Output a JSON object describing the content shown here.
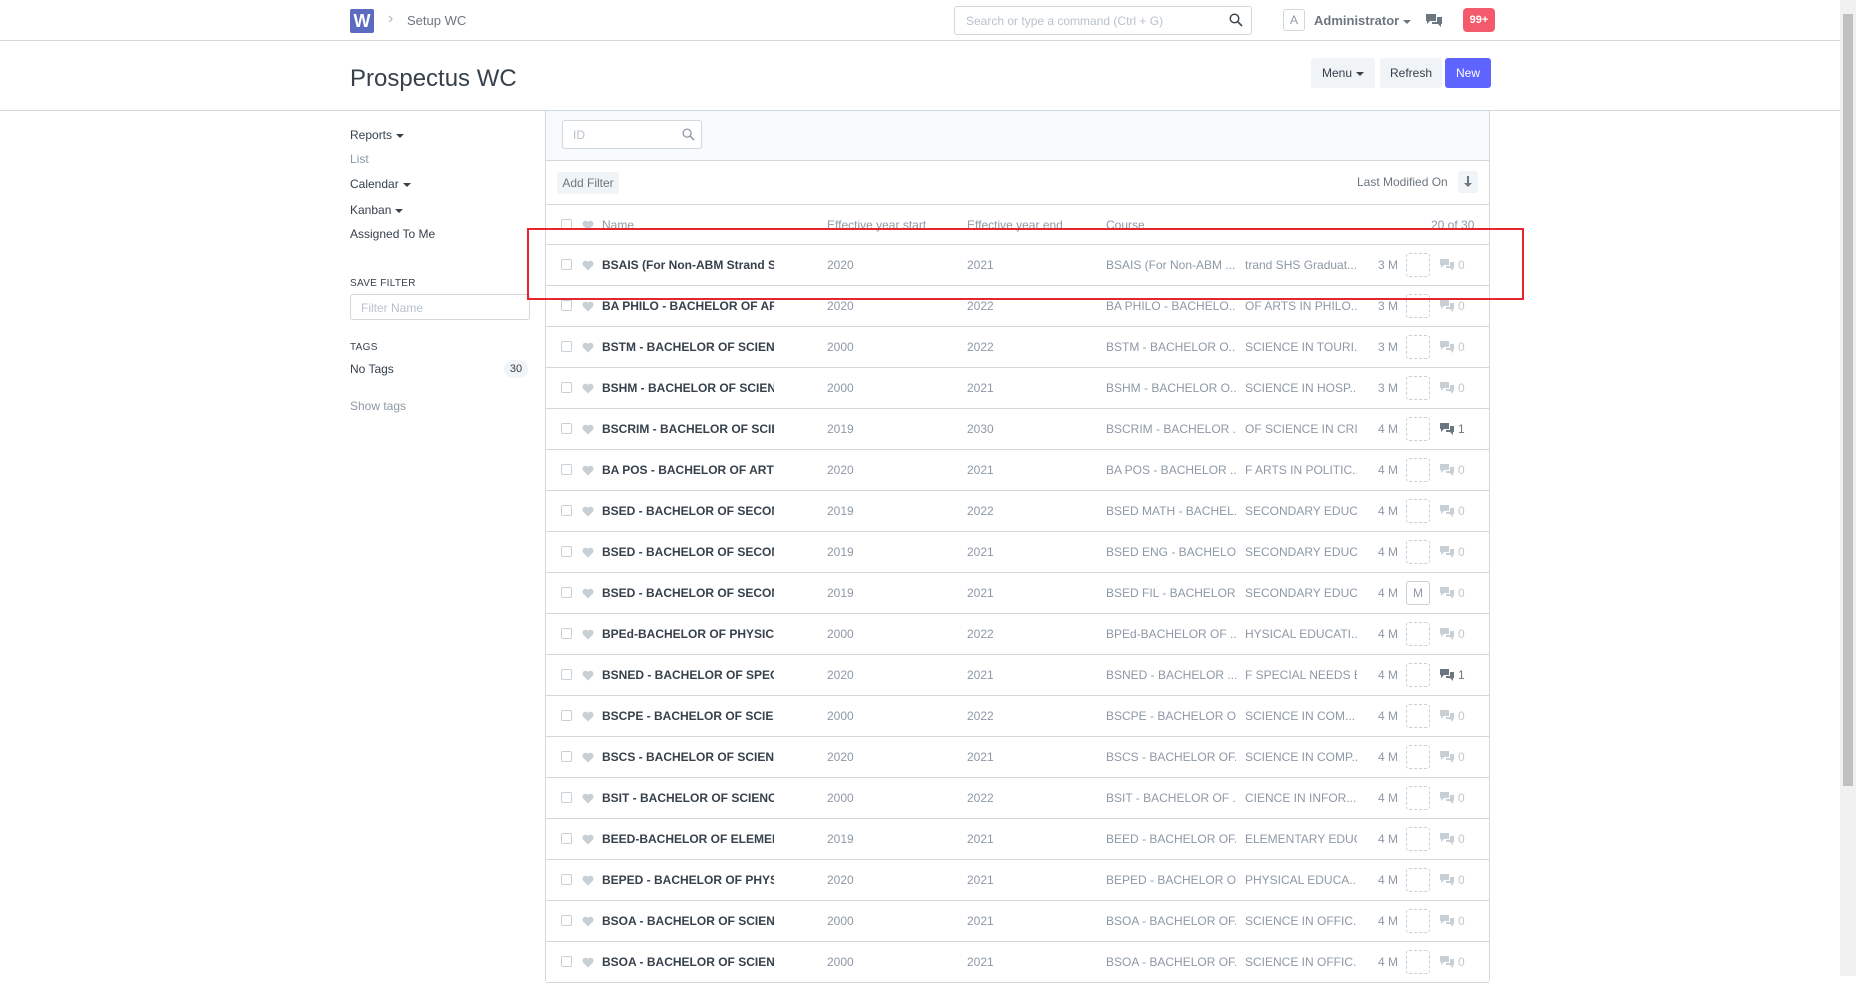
{
  "navbar": {
    "logo": "W",
    "breadcrumb": "Setup WC",
    "search_placeholder": "Search or type a command (Ctrl + G)",
    "avatar_initial": "A",
    "user": "Administrator",
    "notifications": "99+"
  },
  "page": {
    "title": "Prospectus WC",
    "menu_label": "Menu",
    "refresh_label": "Refresh",
    "new_label": "New"
  },
  "sidebar": {
    "reports": "Reports",
    "list": "List",
    "calendar": "Calendar",
    "kanban": "Kanban",
    "assigned": "Assigned To Me",
    "save_filter_head": "SAVE FILTER",
    "filter_placeholder": "Filter Name",
    "tags_head": "TAGS",
    "no_tags": "No Tags",
    "no_tags_count": "30",
    "show_tags": "Show tags"
  },
  "list": {
    "id_placeholder": "ID",
    "add_filter": "Add Filter",
    "sort_label": "Last Modified On",
    "headers": {
      "name": "Name",
      "year_start": "Effective year start",
      "year_end": "Effective year end",
      "course": "Course",
      "count": "20 of 30"
    },
    "rows": [
      {
        "name": "BSAIS (For Non-ABM Strand SHS Graduates)",
        "start": "2020",
        "end": "2021",
        "course1": "BSAIS (For Non-ABM ...",
        "course2": "trand SHS Graduat...",
        "modified": "3 M",
        "assign": "",
        "comments": "0"
      },
      {
        "name": "BA PHILO - BACHELOR OF ARTS IN PHILOSOPHY",
        "start": "2020",
        "end": "2022",
        "course1": "BA PHILO - BACHELO...",
        "course2": "OF ARTS IN PHILO...",
        "modified": "3 M",
        "assign": "",
        "comments": "0"
      },
      {
        "name": "BSTM - BACHELOR OF SCIENCE IN TOURISM",
        "start": "2000",
        "end": "2022",
        "course1": "BSTM - BACHELOR O...",
        "course2": "SCIENCE IN TOURI...",
        "modified": "3 M",
        "assign": "",
        "comments": "0"
      },
      {
        "name": "BSHM - BACHELOR OF SCIENCE IN HOSPITALITY",
        "start": "2000",
        "end": "2021",
        "course1": "BSHM - BACHELOR O...",
        "course2": "SCIENCE IN HOSP...",
        "modified": "3 M",
        "assign": "",
        "comments": "0"
      },
      {
        "name": "BSCRIM - BACHELOR OF SCIENCE IN CRIMINOLOGY",
        "start": "2019",
        "end": "2030",
        "course1": "BSCRIM - BACHELOR ...",
        "course2": "OF SCIENCE IN CRI...",
        "modified": "4 M",
        "assign": "",
        "comments": "1"
      },
      {
        "name": "BA POS - BACHELOR OF ARTS IN POLITICAL SCIENCE",
        "start": "2020",
        "end": "2021",
        "course1": "BA POS - BACHELOR ...",
        "course2": "F ARTS IN POLITIC...",
        "modified": "4 M",
        "assign": "",
        "comments": "0"
      },
      {
        "name": "BSED - BACHELOR OF SECONDARY EDUCATION",
        "start": "2019",
        "end": "2022",
        "course1": "BSED MATH - BACHEL...",
        "course2": "SECONDARY EDUC...",
        "modified": "4 M",
        "assign": "",
        "comments": "0"
      },
      {
        "name": "BSED - BACHELOR OF SECONDARY EDUCATION",
        "start": "2019",
        "end": "2021",
        "course1": "BSED ENG - BACHELO...",
        "course2": "SECONDARY EDUC...",
        "modified": "4 M",
        "assign": "",
        "comments": "0"
      },
      {
        "name": "BSED - BACHELOR OF SECONDARY EDUCATION",
        "start": "2019",
        "end": "2021",
        "course1": "BSED FIL - BACHELOR...",
        "course2": "SECONDARY EDUC...",
        "modified": "4 M",
        "assign": "M",
        "comments": "0"
      },
      {
        "name": "BPEd-BACHELOR OF PHYSICAL EDUCATION",
        "start": "2000",
        "end": "2022",
        "course1": "BPEd-BACHELOR OF ...",
        "course2": "HYSICAL EDUCATI...",
        "modified": "4 M",
        "assign": "",
        "comments": "0"
      },
      {
        "name": "BSNED - BACHELOR OF SPECIAL NEEDS EDUCATION",
        "start": "2020",
        "end": "2021",
        "course1": "BSNED - BACHELOR ...",
        "course2": "F SPECIAL NEEDS E...",
        "modified": "4 M",
        "assign": "",
        "comments": "1"
      },
      {
        "name": "BSCPE - BACHELOR OF SCIENCE IN COMPUTER ENGINEERING",
        "start": "2000",
        "end": "2022",
        "course1": "BSCPE - BACHELOR O...",
        "course2": "SCIENCE IN COM...",
        "modified": "4 M",
        "assign": "",
        "comments": "0"
      },
      {
        "name": "BSCS - BACHELOR OF SCIENCE IN COMPUTER SCIENCE",
        "start": "2020",
        "end": "2021",
        "course1": "BSCS - BACHELOR OF...",
        "course2": "SCIENCE IN COMP...",
        "modified": "4 M",
        "assign": "",
        "comments": "0"
      },
      {
        "name": "BSIT - BACHELOR OF SCIENCE IN INFORMATION TECHNOLOGY",
        "start": "2000",
        "end": "2022",
        "course1": "BSIT - BACHELOR OF ...",
        "course2": "CIENCE IN INFOR...",
        "modified": "4 M",
        "assign": "",
        "comments": "0"
      },
      {
        "name": "BEED-BACHELOR OF ELEMENTARY EDUCATION",
        "start": "2019",
        "end": "2021",
        "course1": "BEED - BACHELOR OF...",
        "course2": "ELEMENTARY EDUC...",
        "modified": "4 M",
        "assign": "",
        "comments": "0"
      },
      {
        "name": "BEPED - BACHELOR OF PHYSICAL EDUCATION",
        "start": "2020",
        "end": "2021",
        "course1": "BEPED - BACHELOR O...",
        "course2": "PHYSICAL EDUCA...",
        "modified": "4 M",
        "assign": "",
        "comments": "0"
      },
      {
        "name": "BSOA - BACHELOR OF SCIENCE IN OFFICE ADMINISTRATION",
        "start": "2000",
        "end": "2021",
        "course1": "BSOA - BACHELOR OF...",
        "course2": "SCIENCE IN OFFIC...",
        "modified": "4 M",
        "assign": "",
        "comments": "0"
      },
      {
        "name": "BSOA - BACHELOR OF SCIENCE IN OFFICE ADMINISTRATION",
        "start": "2000",
        "end": "2021",
        "course1": "BSOA - BACHELOR OF...",
        "course2": "SCIENCE IN OFFIC...",
        "modified": "4 M",
        "assign": "",
        "comments": "0"
      }
    ]
  },
  "colors": {
    "primary": "#5e64ff",
    "logo": "#5c6bc0",
    "notification": "#f35b6d",
    "highlight": "#e5262f"
  },
  "icons": [
    "logo-w-icon",
    "chevron-right-icon",
    "search-icon",
    "avatar-icon",
    "chat-icon",
    "caret-down-icon",
    "checkbox-icon",
    "heart-icon",
    "comment-icon",
    "sort-desc-icon"
  ]
}
